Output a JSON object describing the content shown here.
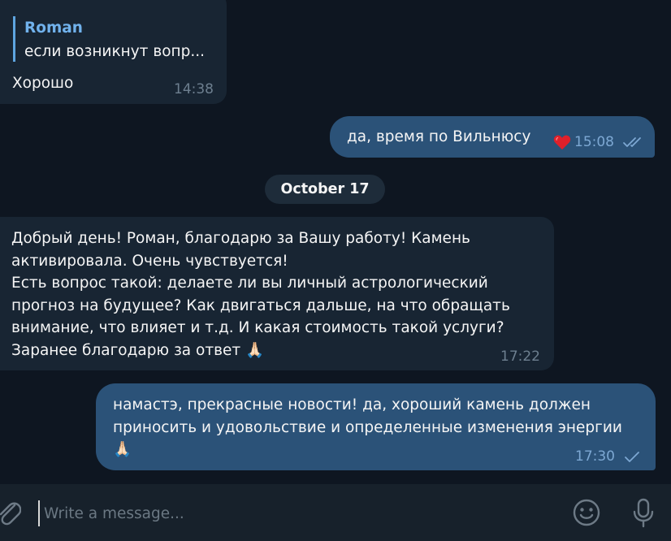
{
  "messages": [
    {
      "id": "b1",
      "direction": "incoming",
      "reply": {
        "name": "Roman",
        "text": "если возникнут вопр..."
      },
      "text": "Хорошо",
      "time": "14:38"
    },
    {
      "id": "b2",
      "direction": "outgoing",
      "text": "да, время по Вильнюсу",
      "reaction": "heart-icon",
      "time": "15:08",
      "status": "read"
    },
    {
      "id": "b3",
      "direction": "incoming",
      "text": "Добрый день! Роман, благодарю за Вашу работу! Камень\nактивировала. Очень чувствуется!\nЕсть вопрос такой: делаете ли вы личный астрологический\nпрогноз на будущее? Как двигаться дальше, на что обращать\nвнимание, что влияет и т.д. И какая стоимость такой услуги?\nЗаранее благодарю за ответ",
      "emoji": "🙏🏻",
      "time": "17:22"
    },
    {
      "id": "b4",
      "direction": "outgoing",
      "text": "намастэ, прекрасные новости! да, хороший камень должен\nприносить и удовольствие и определенные изменения энергии",
      "emoji": "🙏🏻",
      "time": "17:30",
      "status": "sent"
    }
  ],
  "date_separator": "October 17",
  "composer": {
    "placeholder": "Write a message..."
  },
  "icons": {
    "attach": "paperclip-icon",
    "emoji": "emoji-icon",
    "mic": "microphone-icon",
    "reaction": "heart-icon"
  },
  "colors": {
    "background": "#0e1621",
    "incoming_bubble": "#182533",
    "outgoing_bubble": "#2b5278",
    "accent": "#71b2ec",
    "reaction": "#e0202a"
  }
}
